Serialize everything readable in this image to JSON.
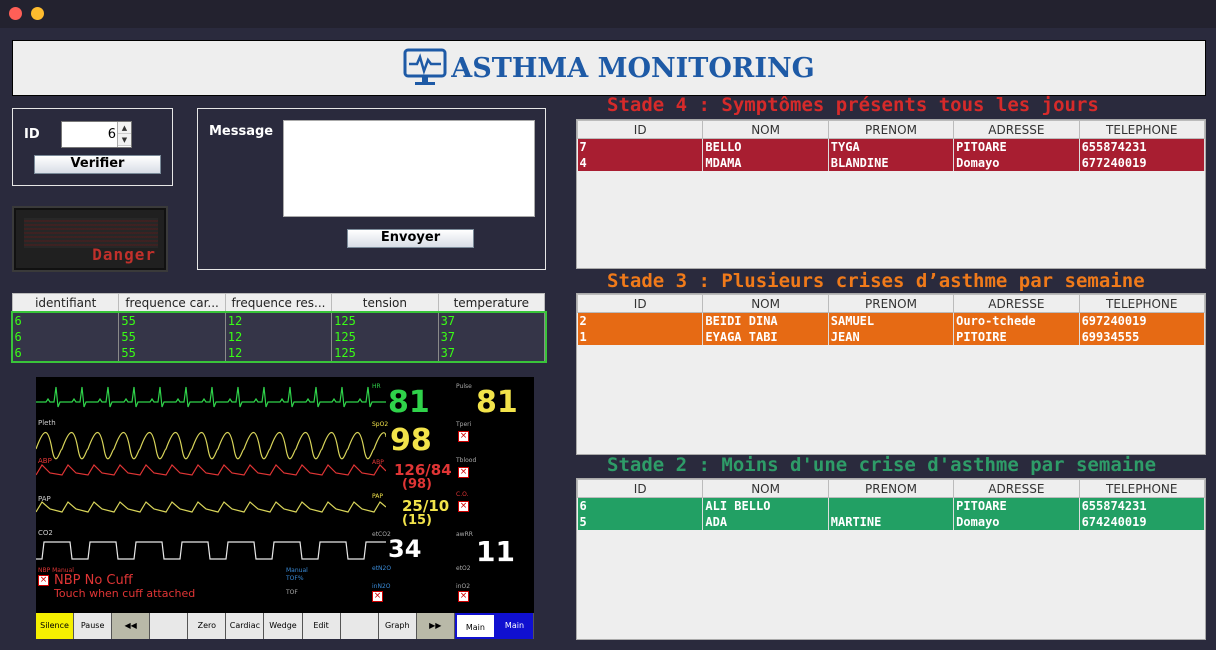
{
  "app": {
    "title": "ASTHMA MONITORING",
    "icon": "monitor-heartbeat-icon",
    "colors": {
      "title": "#1e5aa6",
      "background": "#2a2a3d"
    }
  },
  "id_form": {
    "label": "ID",
    "value": "6",
    "verify_label": "Verifier"
  },
  "message_form": {
    "label": "Message",
    "value": "",
    "send_label": "Envoyer"
  },
  "danger_indicator": {
    "label": "Danger",
    "color": "#c0302b"
  },
  "measurements": {
    "columns": [
      "identifiant",
      "frequence car...",
      "frequence res...",
      "tension",
      "temperature"
    ],
    "rows": [
      [
        "6",
        "55",
        "12",
        "125",
        "37"
      ],
      [
        "6",
        "55",
        "12",
        "125",
        "37"
      ],
      [
        "6",
        "55",
        "12",
        "125",
        "37"
      ]
    ]
  },
  "monitor": {
    "hr_label": "HR",
    "hr_value": "81",
    "pulse_label": "Pulse",
    "pulse_value": "81",
    "spo2_label": "SpO2",
    "spo2_value": "98",
    "abp_label": "ABP",
    "abp_value": "126/84",
    "abp_mean": "(98)",
    "pap_label": "PAP",
    "pap_value": "25/10",
    "pap_mean": "(15)",
    "etco2_label": "etCO2",
    "etco2_value": "34",
    "awrr_label": "awRR",
    "awrr_value": "11",
    "pleth_label": "Pleth",
    "co2_label": "CO2",
    "tperi_label": "Tperi",
    "tblood_label": "Tblood",
    "co_label": "C.O.",
    "eto2_label": "etO2",
    "ino2_label": "inO2",
    "tof_manual_label": "Manual",
    "tof_label": "TOF%",
    "tof2_label": "TOF",
    "etn2o_label": "etN2O",
    "inn2o_label": "inN2O",
    "nbp_small": "NBP Manual",
    "nbp_title": "NBP No Cuff",
    "nbp_msg": "Touch when cuff attached",
    "toolbar": [
      "Silence",
      "Pause Alarms",
      "◀◀",
      "",
      "Zero Press",
      "Cardiac Output",
      "Wedge",
      "Edit",
      "",
      "Graph Trends",
      "▶▶",
      "Main Setup",
      "Main Screen"
    ]
  },
  "stages": [
    {
      "title": "Stade 4 : Symptômes présents tous les jours",
      "color": "#d62a2a",
      "row_color": "#a81e31",
      "columns": [
        "ID",
        "NOM",
        "PRENOM",
        "ADRESSE",
        "TELEPHONE"
      ],
      "rows": [
        [
          "7",
          " BELLO",
          "TYGA",
          "PITOARE",
          "655874231"
        ],
        [
          "4",
          "MDAMA",
          "BLANDINE",
          "Domayo",
          "677240019"
        ]
      ]
    },
    {
      "title": "Stade 3 : Plusieurs crises d’asthme par semaine",
      "color": "#f07a1a",
      "row_color": "#e66a14",
      "columns": [
        "ID",
        "NOM",
        "PRENOM",
        "ADRESSE",
        "TELEPHONE"
      ],
      "rows": [
        [
          "2",
          "BEIDI DINA",
          "SAMUEL",
          "Ouro-tchede",
          "697240019"
        ],
        [
          "1",
          "EYAGA TABI",
          "JEAN",
          "PITOIRE",
          "69934555"
        ]
      ]
    },
    {
      "title": "Stade 2 : Moins d'une crise d'asthme par semaine",
      "color": "#2e9c68",
      "row_color": "#22a064",
      "columns": [
        "ID",
        "NOM",
        "PRENOM",
        "ADRESSE",
        "TELEPHONE"
      ],
      "rows": [
        [
          "6",
          "ALI BELLO",
          "",
          "PITOARE",
          "655874231"
        ],
        [
          "5",
          "ADA",
          "MARTINE",
          "Domayo",
          "674240019"
        ]
      ]
    }
  ]
}
